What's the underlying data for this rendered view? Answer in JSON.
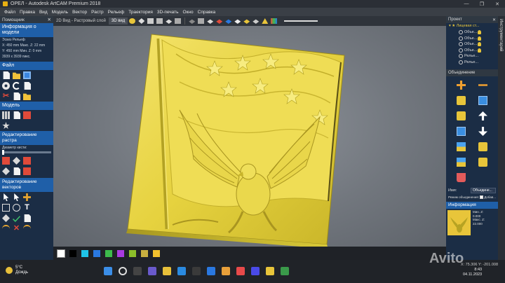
{
  "window": {
    "title": "ОРЕЛ - Autodesk ArtCAM Premium 2018",
    "controls": [
      "—",
      "❐",
      "✕"
    ]
  },
  "menu": [
    "Файл",
    "Правка",
    "Вид",
    "Модель",
    "Вектор",
    "Растр",
    "Рельеф",
    "Траектория",
    "3D-печать",
    "Окно",
    "Справка"
  ],
  "left_panel": {
    "header": "Помощник",
    "model_info_title": "Информация о модели",
    "model_info_lines": [
      "Эскиз      Рельеф",
      "X: 450 mm   Макс. Z: 22 mm",
      "Y: 450 mm   Мин. Z: 0 mm",
      "3939 x 3939 пикс."
    ],
    "file_title": "Файл",
    "model_title": "Модель",
    "raster_title": "Редактирование растра",
    "raster_slider_label": "Диаметр кисти:",
    "vector_title": "Редактирование векторов"
  },
  "toolbar": {
    "tabs": [
      "2D Вид - Растровый слой",
      "3D вид"
    ],
    "active_tab": "3D вид"
  },
  "colors": {
    "swatches": [
      "#ffffff",
      "#000000",
      "#1fc4e8",
      "#2a78e0",
      "#3dbb4c",
      "#a93be0",
      "#8cbf2a",
      "#c8b040",
      "#f2c12e"
    ],
    "relief": "#e8d645",
    "accent": "#1f5fa8"
  },
  "status": {
    "coords": "X: 75.306    Y: -201.008"
  },
  "project_panel": {
    "header": "Проект",
    "root": "Лицевая ст...",
    "items": [
      "Объе...",
      "Объе...",
      "Объе...",
      "Объе...",
      "Релье...",
      "Релье..."
    ]
  },
  "merge_panel": {
    "header": "Объединение",
    "name_label": "Имя:",
    "name_value": "Объедине...",
    "mode_label": "Режим объединения:",
    "mode_value": "Добав..."
  },
  "info_panel": {
    "header": "Информация",
    "lines": [
      "Мин. Z:",
      "0.000",
      "Макс. Z:",
      "22.000"
    ]
  },
  "vertical_tab": "Инструментарий",
  "taskbar": {
    "weather_temp": "5°C",
    "weather_desc": "Дождь",
    "lang": "ENG",
    "time": "8:43",
    "date": "04.11.2023"
  },
  "watermark": "Avito"
}
